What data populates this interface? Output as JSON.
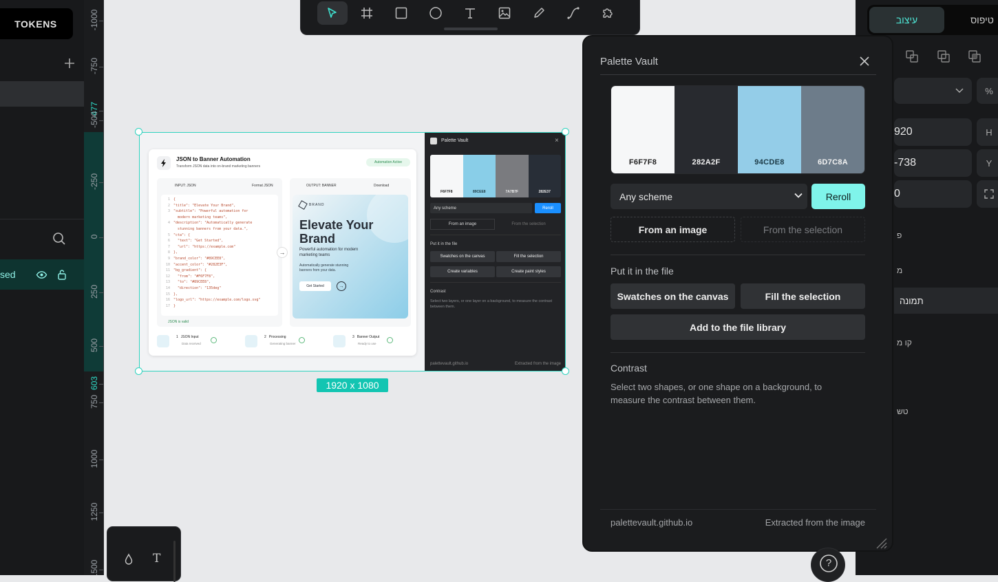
{
  "left_panel": {
    "tokens_label": "TOKENS",
    "layer_name": "sed"
  },
  "ruler": {
    "labels": [
      "-1000",
      "-750",
      "-477",
      "-500",
      "-250",
      "0",
      "250",
      "500",
      "603",
      "750",
      "1000",
      "1250",
      "1500"
    ],
    "accent_labels": [
      "-477",
      "603"
    ]
  },
  "toolbar": {
    "tools": [
      "pointer-icon",
      "frame-icon",
      "rectangle-icon",
      "ellipse-icon",
      "text-icon",
      "image-icon",
      "pencil-icon",
      "path-icon",
      "plugin-icon"
    ],
    "active_tool": "pointer-icon"
  },
  "canvas": {
    "board_size": "1920 x 1080",
    "selection_color": "#2ED3BF"
  },
  "preview": {
    "app_title": "JSON to Banner Automation",
    "app_subtitle": "Transform JSON data into on-brand marketing banners",
    "status_badge": "Automation Active",
    "input_header": "INPUT: JSON",
    "format_btn": "Format JSON",
    "output_header": "OUTPUT: BANNER",
    "download_btn": "Download",
    "json_lines": [
      "{",
      "\"title\": \"Elevate Your Brand\",",
      "\"subtitle\": \"Powerful automation for",
      "  modern marketing teams\",",
      "\"description\": \"Automatically generate",
      "  stunning banners from your data.\",",
      "\"cta\": {",
      "  \"text\": \"Get Started\",",
      "  \"url\": \"https://example.com\"",
      "},",
      "\"brand_color\": \"#89CEE8\",",
      "\"accent_color\": \"#282E3F\",",
      "\"bg_gradient\": {",
      "  \"from\": \"#F6F7F8\",",
      "  \"to\": \"#89CEE8\",",
      "  \"direction\": \"135deg\"",
      "},",
      "\"logo_url\": \"https://example.com/logo.svg\"",
      "}"
    ],
    "json_line_numbers": [
      "1",
      "2",
      "3",
      "",
      "4",
      "",
      "5",
      "6",
      "7",
      "8",
      "9",
      "10",
      "11",
      "12",
      "13",
      "14",
      "15",
      "16",
      "17",
      "18"
    ],
    "json_valid": "JSON is valid",
    "banner_brand": "BRAND",
    "banner_title": "Elevate Your Brand",
    "banner_subtitle": "Powerful automation for modern marketing teams",
    "banner_desc": "Automatically generate stunning banners from your data.",
    "banner_cta": "Get Started",
    "steps": [
      {
        "num": "1",
        "title": "JSON Input",
        "sub": "Data received"
      },
      {
        "num": "2",
        "title": "Processing",
        "sub": "Generating banner"
      },
      {
        "num": "3",
        "title": "Banner Output",
        "sub": "Ready to use"
      }
    ],
    "mini_plugin": {
      "title": "Palette Vault",
      "swatches": [
        {
          "hex": "F6F7F8",
          "color": "#F6F7F8",
          "text": "#222222"
        },
        {
          "hex": "89CEE8",
          "color": "#89CEE8",
          "text": "#1C3A44"
        },
        {
          "hex": "7A7B7F",
          "color": "#7A7B7F",
          "text": "#F0F0F0"
        },
        {
          "hex": "282E37",
          "color": "#282E37",
          "text": "#F0F0F0"
        }
      ],
      "scheme": "Any scheme",
      "reroll": "Reroll",
      "from_image": "From an image",
      "from_selection": "From the selection",
      "put_head": "Put it in the file",
      "btn1": "Swatches on the canvas",
      "btn2": "Fill the selection",
      "btn3": "Create variables",
      "btn4": "Create paint styles",
      "contrast_head": "Contrast",
      "contrast_desc": "Select two layers, or one layer on a background, to measure the contrast between them.",
      "foot_left": "palettevault.github.io",
      "foot_right": "Extracted from the image"
    }
  },
  "plugin": {
    "title": "Palette Vault",
    "swatches": [
      {
        "hex": "F6F7F8",
        "color": "#F6F7F8",
        "text": "#1E1E1E"
      },
      {
        "hex": "282A2F",
        "color": "#282A2F",
        "text": "#F2F2F2"
      },
      {
        "hex": "94CDE8",
        "color": "#94CDE8",
        "text": "#1B3945"
      },
      {
        "hex": "6D7C8A",
        "color": "#6D7C8A",
        "text": "#F2F2F2"
      }
    ],
    "scheme_select": "Any scheme",
    "reroll_label": "Reroll",
    "from_image_label": "From an image",
    "from_selection_label": "From the selection",
    "put_heading": "Put it in the file",
    "swatches_canvas_label": "Swatches on the canvas",
    "fill_selection_label": "Fill the selection",
    "add_library_label": "Add to the file library",
    "contrast_heading": "Contrast",
    "contrast_desc": "Select two shapes, or one shape on a background, to measure the contrast between them.",
    "footer_left": "palettevault.github.io",
    "footer_right": "Extracted from the image"
  },
  "right_panel": {
    "tab_design": "עיצוב",
    "tab_type": "טיפוס",
    "percent": "%",
    "width_value": "920",
    "h_label": "H",
    "y_value": "-738",
    "y_label": "Y",
    "rot_value": "0",
    "text_fill": "פ",
    "text_m": "מ",
    "image_label": "תמונה",
    "line_label": "קו מ",
    "text_s": "טש"
  },
  "mini_toolbar": {
    "drop_icon": "drop-icon",
    "text_icon": "text-icon",
    "t_glyph": "T"
  },
  "help": {
    "glyph": "?"
  }
}
